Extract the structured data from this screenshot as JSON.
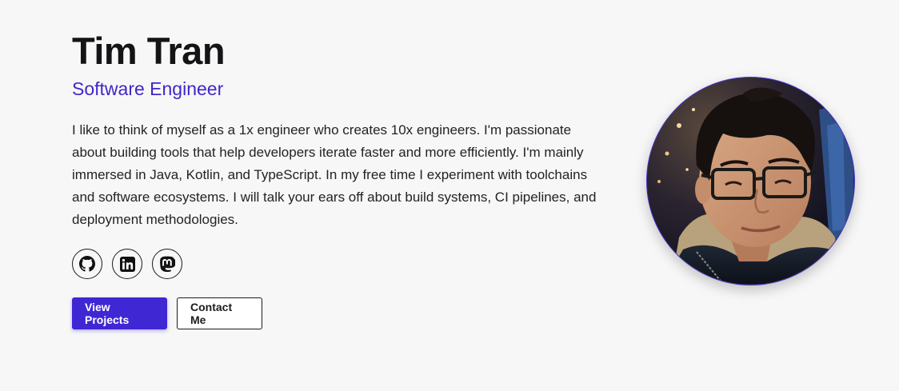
{
  "hero": {
    "name": "Tim Tran",
    "title": "Software Engineer",
    "bio": "I like to think of myself as a 1x engineer who creates 10x engineers. I'm passionate about building tools that help developers iterate faster and more efficiently. I'm mainly immersed in Java, Kotlin, and TypeScript. In my free time I experiment with toolchains and software ecosystems. I will talk your ears off about build systems, CI pipelines, and deployment methodologies."
  },
  "socials": [
    {
      "icon": "github-icon"
    },
    {
      "icon": "linkedin-icon"
    },
    {
      "icon": "mastodon-icon"
    }
  ],
  "buttons": {
    "primary_label": "View Projects",
    "secondary_label": "Contact Me"
  },
  "colors": {
    "accent": "#3f27d4",
    "title": "#3f27c9",
    "background": "#f7f7f8",
    "text": "#1c1c1e"
  }
}
